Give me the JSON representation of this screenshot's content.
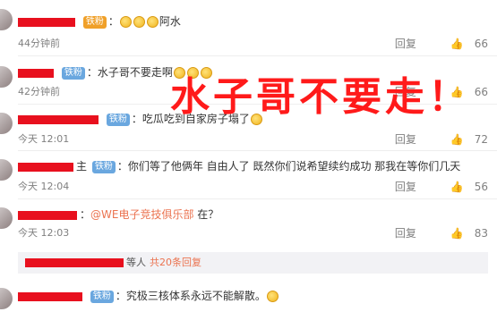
{
  "comments": [
    {
      "badge": "铁粉",
      "badge_color": "#f0a029",
      "text": "阿水",
      "time": "44分钟前",
      "reply": "回复",
      "likes": "66",
      "emoji_count": 3
    },
    {
      "badge": "铁粉",
      "text": "水子哥不要走啊",
      "time": "42分钟前",
      "reply": "回复",
      "likes": "66",
      "emoji_count": 3
    },
    {
      "badge": "铁粉",
      "text": "吃瓜吃到自家房子塌了",
      "time": "今天 12:01",
      "reply": "回复",
      "likes": "72"
    },
    {
      "name_suffix": "主",
      "badge": "铁粉",
      "text": "你们等了他俩年  自由人了  既然你们说希望续约成功  那我在等你们几天",
      "time": "今天 12:04",
      "reply": "回复",
      "likes": "56"
    },
    {
      "mention": "@WE电子竞技俱乐部",
      "text": "在？",
      "time": "今天 12:03",
      "reply": "回复",
      "likes": "83"
    },
    {
      "badge": "铁粉",
      "text": "究极三核体系永远不能解散。",
      "emoji_count": 1
    }
  ],
  "sub_reply": {
    "suffix": "等人",
    "more": "共20条回复"
  },
  "overlay_caption": "水子哥不要走！",
  "colors": {
    "redaction": "#e8101e",
    "badge": "#6aa7df",
    "link": "#eb7350",
    "overlay": "#ff1a1a"
  }
}
